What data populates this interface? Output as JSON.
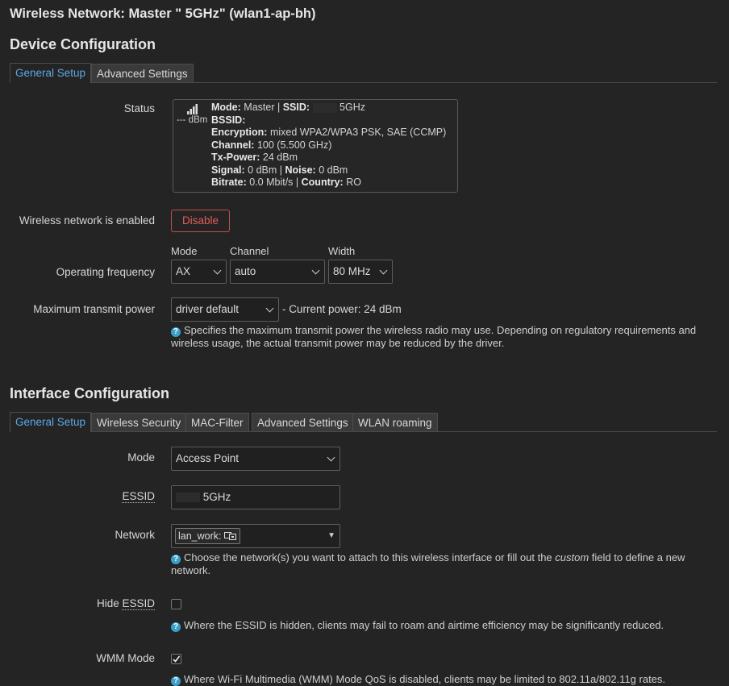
{
  "modal": {
    "title": "Wireless Network: Master \"      5GHz\" (wlan1-ap-bh)"
  },
  "device_config": {
    "heading": "Device Configuration",
    "tabs": [
      "General Setup",
      "Advanced Settings"
    ],
    "status": {
      "label": "Status",
      "signal_text": "--- dBm",
      "mode_label": "Mode:",
      "mode_value": "Master",
      "ssid_label": "SSID:",
      "ssid_value": "5GHz",
      "bssid_label": "BSSID:",
      "encryption_label": "Encryption:",
      "encryption_value": "mixed WPA2/WPA3 PSK, SAE (CCMP)",
      "channel_label": "Channel:",
      "channel_value": "100 (5.500 GHz)",
      "txpower_label": "Tx-Power:",
      "txpower_value": "24 dBm",
      "signal_label": "Signal:",
      "signal_value": "0 dBm",
      "noise_label": "Noise:",
      "noise_value": "0 dBm",
      "bitrate_label": "Bitrate:",
      "bitrate_value": "0.0 Mbit/s",
      "country_label": "Country:",
      "country_value": "RO"
    },
    "enabled": {
      "label": "Wireless network is enabled",
      "button": "Disable"
    },
    "frequency": {
      "label": "Operating frequency",
      "mode_label": "Mode",
      "mode_value": "AX",
      "channel_label": "Channel",
      "channel_value": "auto",
      "width_label": "Width",
      "width_value": "80 MHz"
    },
    "txpower": {
      "label": "Maximum transmit power",
      "value": "driver default",
      "current": "- Current power: 24 dBm",
      "help": "Specifies the maximum transmit power the wireless radio may use. Depending on regulatory requirements and wireless usage, the actual transmit power may be reduced by the driver."
    }
  },
  "iface_config": {
    "heading": "Interface Configuration",
    "tabs": [
      "General Setup",
      "Wireless Security",
      "MAC-Filter",
      "Advanced Settings",
      "WLAN roaming"
    ],
    "mode": {
      "label": "Mode",
      "value": "Access Point"
    },
    "essid": {
      "label": "ESSID",
      "value": "5GHz"
    },
    "network": {
      "label": "Network",
      "chip": "lan_work:",
      "help_before": "Choose the network(s) you want to attach to this wireless interface or fill out the ",
      "help_em": "custom",
      "help_after": " field to define a new network."
    },
    "hide_essid": {
      "label_prefix": "Hide ",
      "label_abbr": "ESSID",
      "checked": false,
      "help": "Where the ESSID is hidden, clients may fail to roam and airtime efficiency may be significantly reduced."
    },
    "wmm": {
      "label": "WMM Mode",
      "checked": true,
      "help": "Where Wi-Fi Multimedia (WMM) Mode QoS is disabled, clients may be limited to 802.11a/802.11g rates."
    }
  },
  "colors": {
    "background": "#242424",
    "accent": "#5aa9e6",
    "danger": "#e05c58",
    "help_icon": "#3aa0c9"
  }
}
